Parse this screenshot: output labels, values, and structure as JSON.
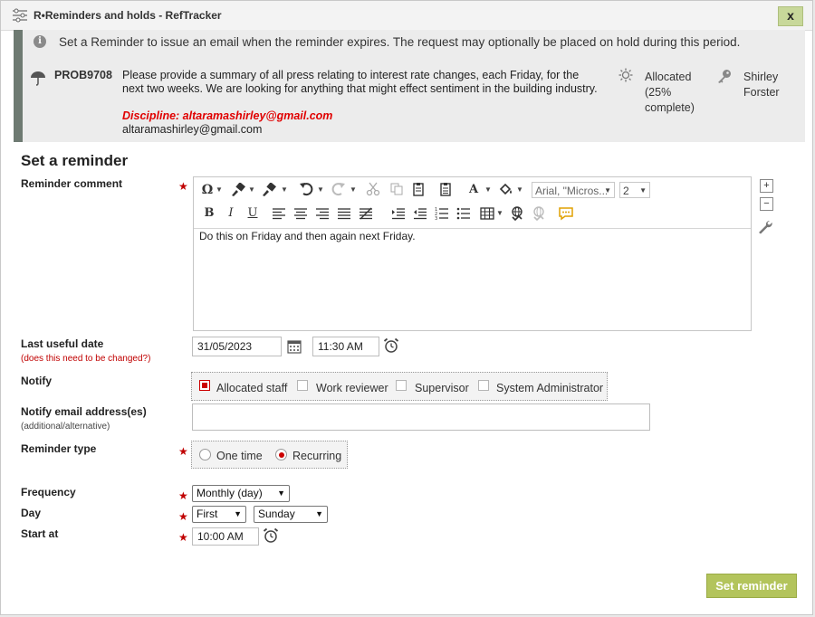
{
  "window": {
    "title": "R•Reminders and holds - RefTracker",
    "close_label": "x"
  },
  "banner": {
    "info_text": "Set a Reminder to issue an email when the reminder expires. The request may optionally be placed on hold during this period.",
    "problem_id": "PROB9708",
    "description": "Please provide a summary of all press relating to interest rate changes, each Friday, for the next two weeks.  We are looking for anything that might effect sentiment in the building industry.",
    "discipline": "Discipline: altaramashirley@gmail.com",
    "email": "altaramashirley@gmail.com",
    "status": "Allocated (25% complete)",
    "progress_percent": 25,
    "assignee": "Shirley Forster"
  },
  "form": {
    "section_title": "Set a reminder",
    "comment": {
      "label": "Reminder comment",
      "value": "Do this on Friday and then again next Friday.",
      "font_name": "Arial, \"Micros...",
      "font_size": "2"
    },
    "last_useful": {
      "label": "Last useful date",
      "sub": "(does this need to be changed?)",
      "date": "31/05/2023",
      "time": "11:30 AM"
    },
    "notify": {
      "label": "Notify",
      "options": [
        {
          "label": "Allocated staff",
          "checked": true
        },
        {
          "label": "Work reviewer",
          "checked": false
        },
        {
          "label": "Supervisor",
          "checked": false
        },
        {
          "label": "System Administrator",
          "checked": false
        }
      ]
    },
    "notify_email": {
      "label": "Notify email address(es)",
      "sub": "(additional/alternative)",
      "value": ""
    },
    "reminder_type": {
      "label": "Reminder type",
      "options": [
        {
          "label": "One time",
          "selected": false
        },
        {
          "label": "Recurring",
          "selected": true
        }
      ]
    },
    "frequency": {
      "label": "Frequency",
      "value": "Monthly (day)"
    },
    "day": {
      "label": "Day",
      "ordinal": "First",
      "weekday": "Sunday"
    },
    "start_at": {
      "label": "Start at",
      "value": "10:00 AM"
    },
    "required_mark": "★",
    "submit_label": "Set reminder"
  },
  "editor_toolbar": {
    "bold": "B",
    "italic": "I",
    "underline": "U",
    "omega": "Ω",
    "font_color": "A"
  },
  "side_controls": {
    "expand": "+",
    "collapse": "−"
  },
  "colors": {
    "accent": "#b3c45c",
    "required": "#c00000",
    "banner_bar": "#6e7a72",
    "discipline": "#e00000"
  }
}
